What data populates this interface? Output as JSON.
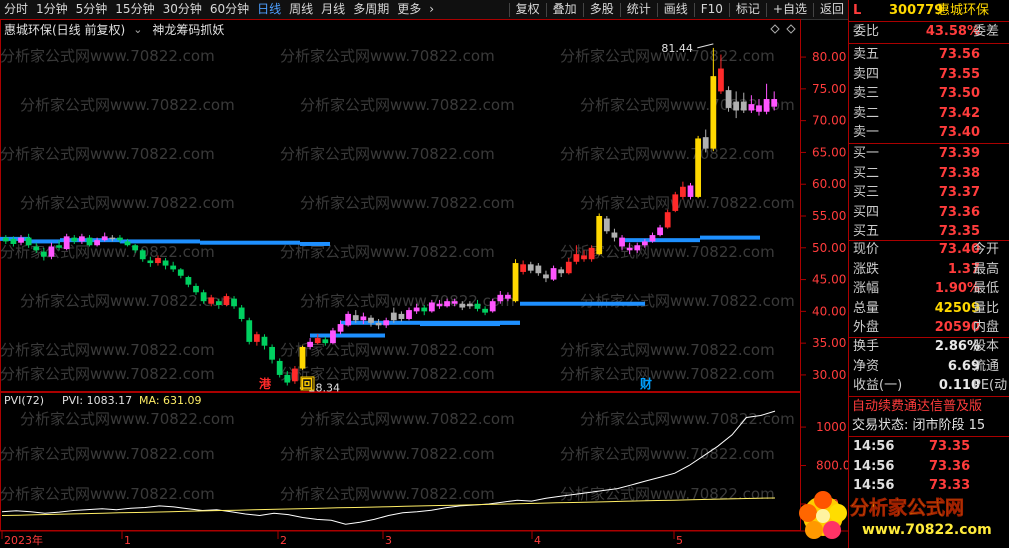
{
  "toolbar": {
    "items": [
      "分时",
      "1分钟",
      "5分钟",
      "15分钟",
      "30分钟",
      "60分钟",
      "日线",
      "周线",
      "月线",
      "多周期",
      "更多"
    ],
    "active_item": "日线",
    "right_items": [
      "复权",
      "叠加",
      "多股",
      "统计",
      "画线",
      "F10",
      "标记",
      "+自选",
      "返回"
    ]
  },
  "title": {
    "stock": "惠城环保(日线 前复权)",
    "indicator": "神龙筹码抓妖"
  },
  "watermark": "分析家公式网www.70822.com",
  "price_axis": [
    80.0,
    75.0,
    70.0,
    65.0,
    60.0,
    55.0,
    50.0,
    45.0,
    40.0,
    35.0,
    30.0
  ],
  "price_axis_labels": [
    "80.00",
    "75.00",
    "70.00",
    "65.00",
    "60.00",
    "55.00",
    "50.00",
    "45.00",
    "40.00",
    "35.00",
    "30.00"
  ],
  "annotations": {
    "high": "81.44",
    "low": "28.34",
    "markers": [
      "港",
      "回",
      "财"
    ]
  },
  "pvi": {
    "label": "PVI(72)",
    "pvi_text": "PVI: 1083.17",
    "ma_text": "MA: 631.09",
    "axis_labels": [
      "1000",
      "800.00",
      "600"
    ]
  },
  "time_axis": [
    "2023年",
    "1",
    "2",
    "3",
    "4",
    "5"
  ],
  "chart_data": {
    "type": "candlestick",
    "title": "惠城环保(日线 前复权)",
    "ylim": [
      27,
      83
    ],
    "candles": [
      {
        "o": 51.0,
        "c": 51.6,
        "h": 52.0,
        "l": 50.6,
        "col": "green"
      },
      {
        "o": 51.4,
        "c": 50.6,
        "h": 51.8,
        "l": 50.2,
        "col": "green"
      },
      {
        "o": 50.8,
        "c": 51.6,
        "h": 52.0,
        "l": 50.4,
        "col": "pink"
      },
      {
        "o": 51.6,
        "c": 50.4,
        "h": 52.2,
        "l": 50.0,
        "col": "green"
      },
      {
        "o": 50.2,
        "c": 49.6,
        "h": 50.8,
        "l": 49.2,
        "col": "green"
      },
      {
        "o": 49.4,
        "c": 48.6,
        "h": 50.0,
        "l": 48.0,
        "col": "green"
      },
      {
        "o": 48.6,
        "c": 50.2,
        "h": 50.8,
        "l": 48.2,
        "col": "pink"
      },
      {
        "o": 50.4,
        "c": 50.0,
        "h": 51.2,
        "l": 49.6,
        "col": "green"
      },
      {
        "o": 49.8,
        "c": 51.8,
        "h": 52.2,
        "l": 49.6,
        "col": "pink"
      },
      {
        "o": 51.6,
        "c": 51.0,
        "h": 52.0,
        "l": 50.6,
        "col": "green"
      },
      {
        "o": 51.0,
        "c": 51.8,
        "h": 52.2,
        "l": 50.6,
        "col": "pink"
      },
      {
        "o": 51.6,
        "c": 50.4,
        "h": 52.0,
        "l": 50.2,
        "col": "green"
      },
      {
        "o": 50.4,
        "c": 51.2,
        "h": 51.6,
        "l": 50.2,
        "col": "pink"
      },
      {
        "o": 51.2,
        "c": 51.8,
        "h": 52.4,
        "l": 51.0,
        "col": "pink"
      },
      {
        "o": 51.4,
        "c": 51.6,
        "h": 52.0,
        "l": 51.0,
        "col": "gray"
      },
      {
        "o": 51.6,
        "c": 51.2,
        "h": 52.0,
        "l": 50.8,
        "col": "green"
      },
      {
        "o": 51.0,
        "c": 50.4,
        "h": 51.4,
        "l": 50.2,
        "col": "green"
      },
      {
        "o": 50.4,
        "c": 49.6,
        "h": 50.6,
        "l": 49.2,
        "col": "green"
      },
      {
        "o": 49.6,
        "c": 48.2,
        "h": 49.8,
        "l": 47.8,
        "col": "green"
      },
      {
        "o": 48.0,
        "c": 47.6,
        "h": 48.6,
        "l": 47.0,
        "col": "green"
      },
      {
        "o": 47.6,
        "c": 48.4,
        "h": 48.8,
        "l": 47.2,
        "col": "red"
      },
      {
        "o": 48.0,
        "c": 47.2,
        "h": 48.4,
        "l": 46.6,
        "col": "green"
      },
      {
        "o": 47.2,
        "c": 46.6,
        "h": 47.8,
        "l": 46.2,
        "col": "green"
      },
      {
        "o": 46.6,
        "c": 45.6,
        "h": 46.8,
        "l": 45.2,
        "col": "green"
      },
      {
        "o": 45.4,
        "c": 44.2,
        "h": 45.6,
        "l": 43.8,
        "col": "green"
      },
      {
        "o": 44.0,
        "c": 43.0,
        "h": 44.4,
        "l": 42.6,
        "col": "green"
      },
      {
        "o": 43.0,
        "c": 41.6,
        "h": 43.4,
        "l": 41.2,
        "col": "green"
      },
      {
        "o": 41.2,
        "c": 42.2,
        "h": 42.6,
        "l": 40.8,
        "col": "red"
      },
      {
        "o": 41.6,
        "c": 41.0,
        "h": 42.0,
        "l": 40.4,
        "col": "green"
      },
      {
        "o": 41.0,
        "c": 42.4,
        "h": 42.8,
        "l": 40.8,
        "col": "red"
      },
      {
        "o": 42.0,
        "c": 40.8,
        "h": 42.4,
        "l": 40.4,
        "col": "green"
      },
      {
        "o": 40.6,
        "c": 38.8,
        "h": 41.0,
        "l": 38.4,
        "col": "green"
      },
      {
        "o": 38.6,
        "c": 35.2,
        "h": 39.0,
        "l": 34.8,
        "col": "green"
      },
      {
        "o": 35.2,
        "c": 36.4,
        "h": 36.8,
        "l": 34.6,
        "col": "red"
      },
      {
        "o": 36.0,
        "c": 34.6,
        "h": 36.4,
        "l": 34.0,
        "col": "green"
      },
      {
        "o": 34.4,
        "c": 32.4,
        "h": 34.8,
        "l": 31.8,
        "col": "green"
      },
      {
        "o": 32.2,
        "c": 30.0,
        "h": 32.6,
        "l": 29.6,
        "col": "green"
      },
      {
        "o": 30.0,
        "c": 28.8,
        "h": 30.6,
        "l": 28.34,
        "col": "green"
      },
      {
        "o": 29.0,
        "c": 31.0,
        "h": 31.4,
        "l": 28.6,
        "col": "red"
      },
      {
        "o": 31.0,
        "c": 34.4,
        "h": 34.6,
        "l": 30.8,
        "col": "yellow"
      },
      {
        "o": 34.4,
        "c": 35.2,
        "h": 35.8,
        "l": 34.0,
        "col": "pink"
      },
      {
        "o": 35.0,
        "c": 35.8,
        "h": 36.4,
        "l": 34.8,
        "col": "red"
      },
      {
        "o": 35.6,
        "c": 35.0,
        "h": 36.0,
        "l": 34.6,
        "col": "green"
      },
      {
        "o": 35.0,
        "c": 37.0,
        "h": 37.4,
        "l": 34.8,
        "col": "pink"
      },
      {
        "o": 36.8,
        "c": 38.0,
        "h": 38.6,
        "l": 36.4,
        "col": "pink"
      },
      {
        "o": 37.8,
        "c": 39.6,
        "h": 40.0,
        "l": 37.6,
        "col": "pink"
      },
      {
        "o": 39.4,
        "c": 38.6,
        "h": 40.2,
        "l": 38.2,
        "col": "gray"
      },
      {
        "o": 38.6,
        "c": 39.2,
        "h": 39.8,
        "l": 38.0,
        "col": "pink"
      },
      {
        "o": 39.0,
        "c": 38.2,
        "h": 39.4,
        "l": 37.6,
        "col": "gray"
      },
      {
        "o": 38.2,
        "c": 37.8,
        "h": 38.8,
        "l": 37.2,
        "col": "gray"
      },
      {
        "o": 37.8,
        "c": 38.6,
        "h": 39.0,
        "l": 37.4,
        "col": "pink"
      },
      {
        "o": 38.6,
        "c": 39.8,
        "h": 40.6,
        "l": 38.2,
        "col": "gray"
      },
      {
        "o": 39.6,
        "c": 38.8,
        "h": 40.0,
        "l": 38.4,
        "col": "gray"
      },
      {
        "o": 38.8,
        "c": 40.2,
        "h": 40.6,
        "l": 38.6,
        "col": "pink"
      },
      {
        "o": 40.0,
        "c": 40.6,
        "h": 41.2,
        "l": 39.6,
        "col": "pink"
      },
      {
        "o": 40.6,
        "c": 40.0,
        "h": 41.0,
        "l": 39.4,
        "col": "green"
      },
      {
        "o": 40.0,
        "c": 41.4,
        "h": 41.8,
        "l": 39.8,
        "col": "pink"
      },
      {
        "o": 41.2,
        "c": 40.8,
        "h": 41.8,
        "l": 40.4,
        "col": "pink"
      },
      {
        "o": 40.8,
        "c": 41.6,
        "h": 42.0,
        "l": 40.6,
        "col": "pink"
      },
      {
        "o": 41.6,
        "c": 41.2,
        "h": 42.0,
        "l": 40.8,
        "col": "pink"
      },
      {
        "o": 41.2,
        "c": 40.6,
        "h": 41.6,
        "l": 40.2,
        "col": "gray"
      },
      {
        "o": 40.8,
        "c": 41.2,
        "h": 41.6,
        "l": 40.4,
        "col": "gray"
      },
      {
        "o": 41.2,
        "c": 40.4,
        "h": 41.8,
        "l": 40.0,
        "col": "green"
      },
      {
        "o": 40.4,
        "c": 39.8,
        "h": 40.8,
        "l": 39.4,
        "col": "green"
      },
      {
        "o": 40.0,
        "c": 41.6,
        "h": 42.0,
        "l": 39.8,
        "col": "pink"
      },
      {
        "o": 41.6,
        "c": 42.6,
        "h": 43.2,
        "l": 41.2,
        "col": "pink"
      },
      {
        "o": 42.6,
        "c": 42.0,
        "h": 43.0,
        "l": 41.6,
        "col": "pink"
      },
      {
        "o": 41.6,
        "c": 47.6,
        "h": 48.2,
        "l": 41.4,
        "col": "yellow"
      },
      {
        "o": 47.4,
        "c": 46.2,
        "h": 48.0,
        "l": 45.8,
        "col": "red"
      },
      {
        "o": 46.4,
        "c": 47.4,
        "h": 47.8,
        "l": 46.0,
        "col": "gray"
      },
      {
        "o": 47.2,
        "c": 46.0,
        "h": 47.6,
        "l": 45.6,
        "col": "gray"
      },
      {
        "o": 45.8,
        "c": 45.2,
        "h": 46.4,
        "l": 44.6,
        "col": "gray"
      },
      {
        "o": 45.0,
        "c": 46.8,
        "h": 47.2,
        "l": 44.8,
        "col": "pink"
      },
      {
        "o": 46.6,
        "c": 46.0,
        "h": 47.0,
        "l": 45.4,
        "col": "gray"
      },
      {
        "o": 46.0,
        "c": 47.8,
        "h": 48.4,
        "l": 45.8,
        "col": "red"
      },
      {
        "o": 47.8,
        "c": 49.0,
        "h": 50.4,
        "l": 47.4,
        "col": "red"
      },
      {
        "o": 48.8,
        "c": 48.2,
        "h": 49.6,
        "l": 47.8,
        "col": "red"
      },
      {
        "o": 48.2,
        "c": 50.0,
        "h": 50.4,
        "l": 47.8,
        "col": "red"
      },
      {
        "o": 49.0,
        "c": 55.0,
        "h": 55.4,
        "l": 48.8,
        "col": "yellow"
      },
      {
        "o": 54.6,
        "c": 52.6,
        "h": 55.0,
        "l": 52.2,
        "col": "gray"
      },
      {
        "o": 52.4,
        "c": 51.6,
        "h": 53.0,
        "l": 51.0,
        "col": "gray"
      },
      {
        "o": 51.6,
        "c": 50.2,
        "h": 52.0,
        "l": 49.6,
        "col": "pink"
      },
      {
        "o": 50.0,
        "c": 49.6,
        "h": 50.8,
        "l": 49.0,
        "col": "pink"
      },
      {
        "o": 49.6,
        "c": 50.4,
        "h": 50.8,
        "l": 49.2,
        "col": "pink"
      },
      {
        "o": 50.4,
        "c": 51.0,
        "h": 51.4,
        "l": 50.0,
        "col": "pink"
      },
      {
        "o": 51.0,
        "c": 52.0,
        "h": 52.4,
        "l": 50.8,
        "col": "pink"
      },
      {
        "o": 52.0,
        "c": 53.2,
        "h": 53.6,
        "l": 51.8,
        "col": "pink"
      },
      {
        "o": 53.2,
        "c": 55.6,
        "h": 56.0,
        "l": 53.0,
        "col": "red"
      },
      {
        "o": 55.8,
        "c": 58.4,
        "h": 58.8,
        "l": 55.6,
        "col": "red"
      },
      {
        "o": 58.0,
        "c": 59.6,
        "h": 60.4,
        "l": 57.6,
        "col": "red"
      },
      {
        "o": 59.8,
        "c": 58.0,
        "h": 60.2,
        "l": 57.6,
        "col": "pink"
      },
      {
        "o": 58.0,
        "c": 67.2,
        "h": 67.6,
        "l": 57.8,
        "col": "yellow"
      },
      {
        "o": 67.4,
        "c": 65.6,
        "h": 68.6,
        "l": 65.0,
        "col": "gray"
      },
      {
        "o": 65.6,
        "c": 77.0,
        "h": 81.44,
        "l": 65.2,
        "col": "yellow"
      },
      {
        "o": 78.2,
        "c": 74.6,
        "h": 80.4,
        "l": 74.2,
        "col": "red"
      },
      {
        "o": 74.8,
        "c": 72.0,
        "h": 75.4,
        "l": 71.4,
        "col": "gray"
      },
      {
        "o": 71.6,
        "c": 73.0,
        "h": 74.6,
        "l": 70.4,
        "col": "gray"
      },
      {
        "o": 73.0,
        "c": 71.6,
        "h": 74.4,
        "l": 71.2,
        "col": "gray"
      },
      {
        "o": 71.6,
        "c": 72.6,
        "h": 74.0,
        "l": 71.2,
        "col": "pink"
      },
      {
        "o": 72.4,
        "c": 71.4,
        "h": 73.4,
        "l": 70.8,
        "col": "pink"
      },
      {
        "o": 71.4,
        "c": 73.4,
        "h": 75.8,
        "l": 71.0,
        "col": "pink"
      },
      {
        "o": 73.4,
        "c": 72.2,
        "h": 74.6,
        "l": 71.6,
        "col": "pink"
      }
    ],
    "chip_segments": [
      {
        "x0": 0,
        "x1": 30,
        "y": 51.4
      },
      {
        "x0": 30,
        "x1": 60,
        "y": 51.0
      },
      {
        "x0": 60,
        "x1": 120,
        "y": 51.2
      },
      {
        "x0": 120,
        "x1": 200,
        "y": 51.0
      },
      {
        "x0": 200,
        "x1": 300,
        "y": 50.8
      },
      {
        "x0": 300,
        "x1": 330,
        "y": 50.6
      },
      {
        "x0": 310,
        "x1": 385,
        "y": 36.2
      },
      {
        "x0": 340,
        "x1": 520,
        "y": 38.2
      },
      {
        "x0": 420,
        "x1": 500,
        "y": 38.0
      },
      {
        "x0": 500,
        "x1": 520,
        "y": 38.2
      },
      {
        "x0": 520,
        "x1": 645,
        "y": 41.2
      },
      {
        "x0": 620,
        "x1": 700,
        "y": 51.2
      },
      {
        "x0": 700,
        "x1": 760,
        "y": 51.6
      }
    ],
    "pvi_series": [
      {
        "name": "PVI",
        "values": [
          560,
          565,
          560,
          552,
          558,
          566,
          571,
          575,
          570,
          578,
          582,
          590,
          585,
          575,
          566,
          570,
          560,
          548,
          540,
          552,
          545,
          530,
          520,
          515,
          495,
          505,
          520,
          540,
          555,
          560,
          568,
          580,
          590,
          595,
          600,
          610,
          620,
          615,
          630,
          640,
          650,
          660,
          670,
          680,
          700,
          720,
          740,
          760,
          800,
          850,
          900,
          960,
          1050,
          1060,
          1083
        ]
      },
      {
        "name": "MA",
        "values": [
          540,
          542,
          544,
          546,
          548,
          550,
          552,
          554,
          556,
          558,
          560,
          562,
          564,
          566,
          568,
          570,
          572,
          574,
          576,
          578,
          580,
          582,
          584,
          586,
          588,
          590,
          592,
          594,
          596,
          598,
          600,
          602,
          604,
          606,
          608,
          610,
          612,
          614,
          616,
          618,
          620,
          622,
          624,
          626,
          628,
          630,
          631
        ]
      }
    ]
  },
  "quote_panel": {
    "header_l": "L",
    "code": "300779",
    "name": "惠城环保",
    "weibi_label": "委比",
    "weibi_value": "43.58%",
    "weicha_label": "委差",
    "asks": [
      {
        "label": "卖五",
        "price": "73.56"
      },
      {
        "label": "卖四",
        "price": "73.55"
      },
      {
        "label": "卖三",
        "price": "73.50"
      },
      {
        "label": "卖二",
        "price": "73.42"
      },
      {
        "label": "卖一",
        "price": "73.40"
      }
    ],
    "bids": [
      {
        "label": "买一",
        "price": "73.39"
      },
      {
        "label": "买二",
        "price": "73.38"
      },
      {
        "label": "买三",
        "price": "73.37"
      },
      {
        "label": "买四",
        "price": "73.36"
      },
      {
        "label": "买五",
        "price": "73.35"
      }
    ],
    "stats": [
      {
        "label": "现价",
        "value": "73.40",
        "extra": "今开",
        "cls": "red"
      },
      {
        "label": "涨跌",
        "value": "1.37",
        "extra": "最高",
        "cls": "red"
      },
      {
        "label": "涨幅",
        "value": "1.90%",
        "extra": "最低",
        "cls": "red"
      },
      {
        "label": "总量",
        "value": "42509",
        "extra": "量比",
        "cls": "yel"
      },
      {
        "label": "外盘",
        "value": "20590",
        "extra": "内盘",
        "cls": "red"
      }
    ],
    "stats2": [
      {
        "label": "换手",
        "value": "2.86%",
        "extra": "股本"
      },
      {
        "label": "净资",
        "value": "6.69",
        "extra": "流通"
      },
      {
        "label": "收益(一)",
        "value": "0.110",
        "extra": "PE(动"
      }
    ],
    "notice": "自动续费通达信普及版",
    "trade_status": "交易状态: 闭市阶段 15",
    "ticks": [
      {
        "time": "14:56",
        "price": "73.35"
      },
      {
        "time": "14:56",
        "price": "73.36"
      },
      {
        "time": "14:56",
        "price": "73.33"
      }
    ]
  },
  "logo": {
    "text": "分析家公式网",
    "url_text": "www.70822.com"
  }
}
